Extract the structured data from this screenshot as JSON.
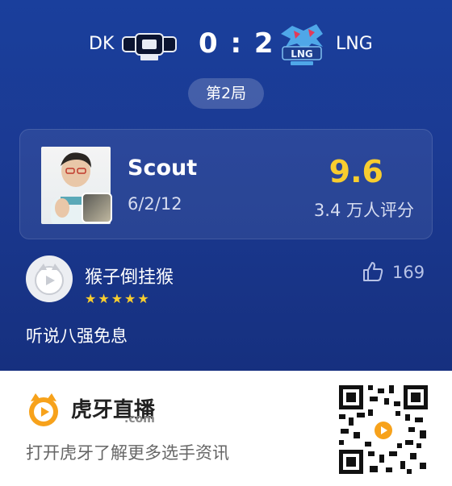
{
  "match": {
    "team_left": "DK",
    "team_right": "LNG",
    "score": "0 : 2",
    "round": "第2局"
  },
  "player": {
    "name": "Scout",
    "kda": "6/2/12",
    "rating": "9.6",
    "raters": "3.4 万人评分"
  },
  "comment": {
    "user": "猴子倒挂猴",
    "stars": "★★★★★",
    "star_count": 5,
    "likes": "169",
    "text": "听说八强免息"
  },
  "footer": {
    "brand": "虎牙直播",
    "domain": ".com",
    "promo": "打开虎牙了解更多选手资讯"
  },
  "colors": {
    "accent": "#f8cd2f",
    "background": "#1a3f9c",
    "brand_orange": "#f7a21b"
  },
  "icons": [
    "dk-logo",
    "lng-logo",
    "thumbs-up-icon",
    "huya-logo",
    "qr-code"
  ]
}
